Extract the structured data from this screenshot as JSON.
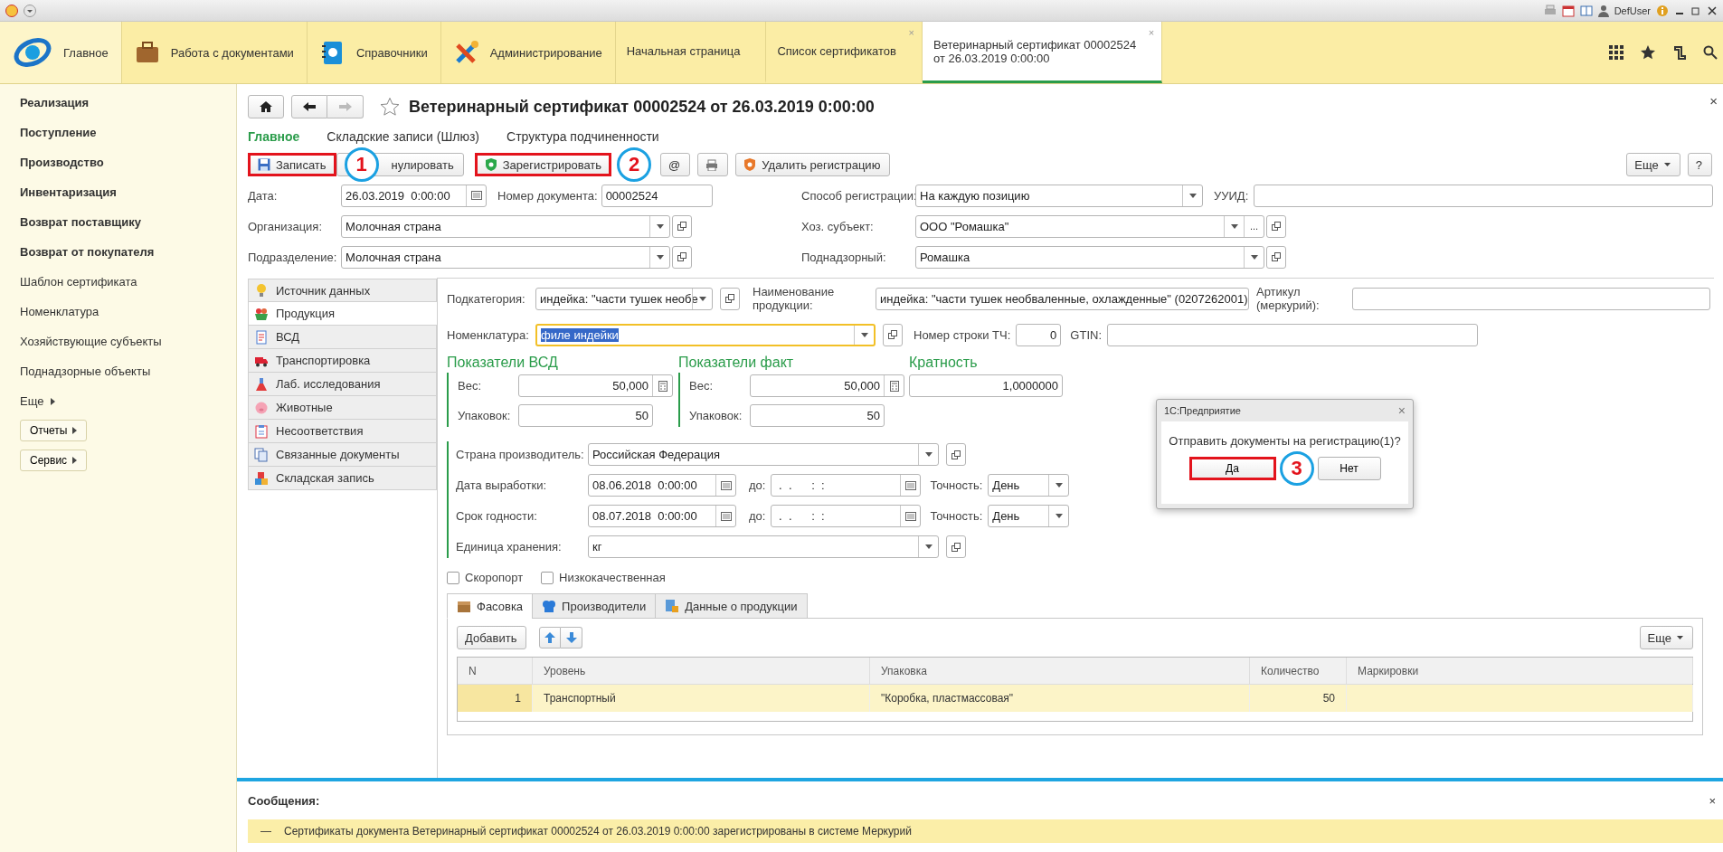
{
  "title_bar": {
    "user": "DefUser"
  },
  "sections": [
    {
      "label": "Главное",
      "selected": true
    },
    {
      "label": "Работа с документами",
      "selected": false
    },
    {
      "label": "Справочники",
      "selected": false
    },
    {
      "label": "Администрирование",
      "selected": false
    }
  ],
  "open_tabs": [
    {
      "lines": [
        "Начальная страница"
      ],
      "selected": false
    },
    {
      "lines": [
        "Список сертификатов"
      ],
      "selected": false,
      "close": "×"
    },
    {
      "lines": [
        "Ветеринарный сертификат 00002524",
        "от 26.03.2019 0:00:00"
      ],
      "selected": true,
      "close": "×"
    }
  ],
  "sidebar": [
    {
      "label": "Реализация",
      "kind": "bold"
    },
    {
      "label": "Поступление",
      "kind": "bold"
    },
    {
      "label": "Производство",
      "kind": "bold"
    },
    {
      "label": "Инвентаризация",
      "kind": "bold"
    },
    {
      "label": "Возврат поставщику",
      "kind": "bold"
    },
    {
      "label": "Возврат от покупателя",
      "kind": "bold"
    },
    {
      "label": "Шаблон сертификата",
      "kind": "plain"
    },
    {
      "label": "Номенклатура",
      "kind": "plain"
    },
    {
      "label": "Хозяйствующие субъекты",
      "kind": "plain"
    },
    {
      "label": "Поднадзорные объекты",
      "kind": "plain"
    },
    {
      "label": "Еще",
      "kind": "more"
    },
    {
      "label": "Отчеты",
      "kind": "button"
    },
    {
      "label": "Сервис",
      "kind": "button"
    }
  ],
  "form": {
    "title": "Ветеринарный сертификат 00002524 от 26.03.2019 0:00:00",
    "close": "×",
    "nav_tabs": [
      {
        "label": "Главное",
        "selected": true
      },
      {
        "label": "Складские записи (Шлюз)",
        "selected": false
      },
      {
        "label": "Структура подчиненности",
        "selected": false
      }
    ],
    "toolbar": [
      {
        "label": "Записать",
        "highlighted": true,
        "callout": "1"
      },
      {
        "label": "нулировать",
        "highlighted": false
      },
      {
        "label": "Зарегистрировать",
        "highlighted": true,
        "callout": "2"
      },
      {
        "label": "@",
        "highlighted": false
      },
      {
        "label": "Удалить регистрацию",
        "highlighted": false
      }
    ],
    "more_button": "Еще",
    "help_button": "?",
    "date": {
      "label": "Дата:",
      "value": "26.03.2019  0:00:00"
    },
    "doc_number": {
      "label": "Номер документа:",
      "value": "00002524"
    },
    "organization": {
      "label": "Организация:",
      "value": "Молочная страна"
    },
    "department": {
      "label": "Подразделение:",
      "value": "Молочная страна"
    },
    "reg_method": {
      "label": "Способ регистрации:",
      "value": "На каждую позицию"
    },
    "uuid": {
      "label": "УУИД:"
    },
    "business_entity": {
      "label": "Хоз. субъект:",
      "value": "ООО \"Ромашка\"",
      "ellipsis": "..."
    },
    "supervised": {
      "label": "Поднадзорный:",
      "value": "Ромашка"
    },
    "pages": [
      {
        "label": "Источник данных",
        "selected": false
      },
      {
        "label": "Продукция",
        "selected": true
      },
      {
        "label": "ВСД",
        "selected": false
      },
      {
        "label": "Транспортировка",
        "selected": false
      },
      {
        "label": "Лаб. исследования",
        "selected": false
      },
      {
        "label": "Животные",
        "selected": false
      },
      {
        "label": "Несоответствия",
        "selected": false
      },
      {
        "label": "Связанные документы",
        "selected": false
      },
      {
        "label": "Складская запись",
        "selected": false
      }
    ],
    "product": {
      "subcategory": {
        "label": "Подкатегория:",
        "value": "индейка: \"части тушек необе"
      },
      "product_name": {
        "label": "Наименование продукции:",
        "value": "индейка: \"части тушек необваленные, охлажденные\" (0207262001)"
      },
      "article": {
        "label": "Артикул (меркурий):"
      },
      "nomenclature": {
        "label": "Номенклатура:",
        "value": "филе индейки"
      },
      "row_number": {
        "label": "Номер строки ТЧ:",
        "value": "0"
      },
      "gtin": {
        "label": "GTIN:"
      },
      "vsd": {
        "title": "Показатели ВСД",
        "weight_label": "Вес:",
        "weight": "50,000",
        "packages_label": "Упаковок:",
        "packages": "50"
      },
      "fact": {
        "title": "Показатели факт",
        "weight_label": "Вес:",
        "weight": "50,000",
        "packages_label": "Упаковок:",
        "packages": "50"
      },
      "multiplicity": {
        "title": "Кратность",
        "value": "1,0000000"
      },
      "country": {
        "label": "Страна производитель:",
        "value": "Российская Федерация"
      },
      "production_date": {
        "label": "Дата выработки:",
        "value": "08.06.2018  0:00:00",
        "to_label": "до:",
        "to_value": " .  .      :  :",
        "precision_label": "Точность:",
        "precision": "День"
      },
      "expiry_date": {
        "label": "Срок годности:",
        "value": "08.07.2018  0:00:00",
        "to_label": "до:",
        "to_value": " .  .      :  :",
        "precision_label": "Точность:",
        "precision": "День"
      },
      "unit": {
        "label": "Единица хранения:",
        "value": "кг"
      },
      "checkboxes": [
        {
          "label": "Скоропорт",
          "checked": false
        },
        {
          "label": "Низкокачественная",
          "checked": false
        }
      ]
    },
    "sub_tabs": [
      {
        "label": "Фасовка",
        "selected": true
      },
      {
        "label": "Производители",
        "selected": false
      },
      {
        "label": "Данные о продукции",
        "selected": false
      }
    ],
    "table_add": "Добавить",
    "table_more": "Еще",
    "table": {
      "columns": [
        "N",
        "Уровень",
        "Упаковка",
        "Количество",
        "Маркировки"
      ],
      "rows": [
        {
          "cells": [
            "1",
            "Транспортный",
            "\"Коробка, пластмассовая\"",
            "50",
            ""
          ],
          "selected": true
        }
      ]
    }
  },
  "messages": {
    "title": "Сообщения:",
    "close": "×",
    "items": [
      {
        "marker": "—",
        "text": "Сертификаты документа Ветеринарный сертификат 00002524 от 26.03.2019 0:00:00 зарегистрированы в системе Меркурий"
      }
    ]
  },
  "dialog": {
    "title": "1С:Предприятие",
    "close": "×",
    "text": "Отправить документы на регистрацию(1)?",
    "buttons": [
      {
        "label": "Да",
        "highlighted": true,
        "callout": "3"
      },
      {
        "label": "Нет",
        "highlighted": false
      }
    ]
  }
}
